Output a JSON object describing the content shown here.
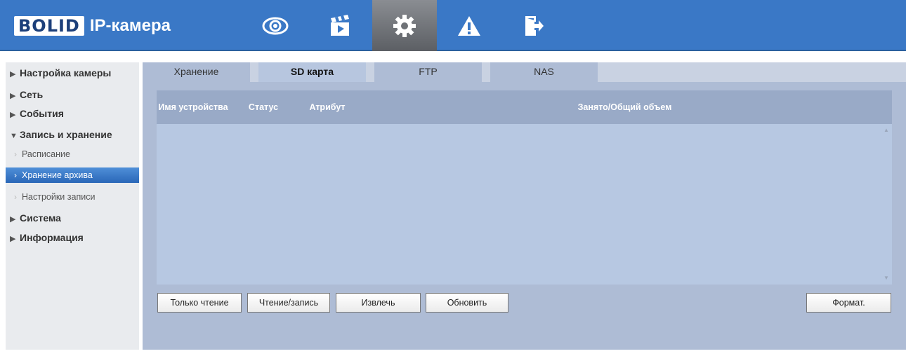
{
  "header": {
    "logo_text": "BOLID",
    "logo_suffix": "IP-камера",
    "nav_icons": [
      "eye-icon",
      "clapperboard-icon",
      "gear-icon",
      "warning-icon",
      "logout-icon"
    ],
    "active_nav": "gear-icon"
  },
  "sidebar": {
    "items": [
      {
        "label": "Настройка камеры"
      },
      {
        "label": "Сеть"
      },
      {
        "label": "События"
      },
      {
        "label": "Запись и хранение"
      },
      {
        "label": "Система"
      },
      {
        "label": "Информация"
      }
    ],
    "subitems": [
      {
        "label": "Расписание"
      },
      {
        "label": "Хранение архива"
      },
      {
        "label": "Настройки записи"
      }
    ],
    "active_subitem": "Хранение архива"
  },
  "tabs": [
    {
      "label": "Хранение"
    },
    {
      "label": "SD карта"
    },
    {
      "label": "FTP"
    },
    {
      "label": "NAS"
    }
  ],
  "active_tab": "SD карта",
  "table": {
    "headers": [
      "Имя устройства",
      "Статус",
      "Атрибут",
      "Занято/Общий объем"
    ]
  },
  "buttons": {
    "read_only": "Только чтение",
    "read_write": "Чтение/запись",
    "eject": "Извлечь",
    "refresh": "Обновить",
    "format": "Формат."
  },
  "colors": {
    "header_bg": "#3a78c6",
    "sidebar_active": "#2a67b8",
    "table_header": "#99aac7",
    "panel_bg": "#aebcd5"
  }
}
